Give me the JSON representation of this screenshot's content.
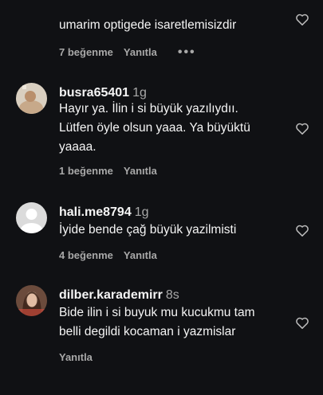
{
  "comments": [
    {
      "text": "umarim optigede isaretlemisizdir",
      "likes_label": "7 beğenme",
      "reply_label": "Yanıtla",
      "more_label": "•••",
      "like_icon": "heart-outline-icon"
    },
    {
      "username": "busra65401",
      "time": "1g",
      "text": "Hayır ya. İlin i si büyük yazılıydıı.\nLütfen öyle olsun yaaa. Ya büyüktü\nyaaaa.",
      "likes_label": "1 beğenme",
      "reply_label": "Yanıtla",
      "like_icon": "heart-outline-icon"
    },
    {
      "username": "hali.me8794",
      "time": "1g",
      "text": "İyide bende çağ büyük yazilmisti",
      "likes_label": "4 beğenme",
      "reply_label": "Yanıtla",
      "like_icon": "heart-outline-icon"
    },
    {
      "username": "dilber.karademirr",
      "time": "8s",
      "text": "Bide ilin i si buyuk mu kucukmu tam\nbelli degildi kocaman i yazmislar",
      "reply_label": "Yanıtla",
      "like_icon": "heart-outline-icon"
    }
  ]
}
